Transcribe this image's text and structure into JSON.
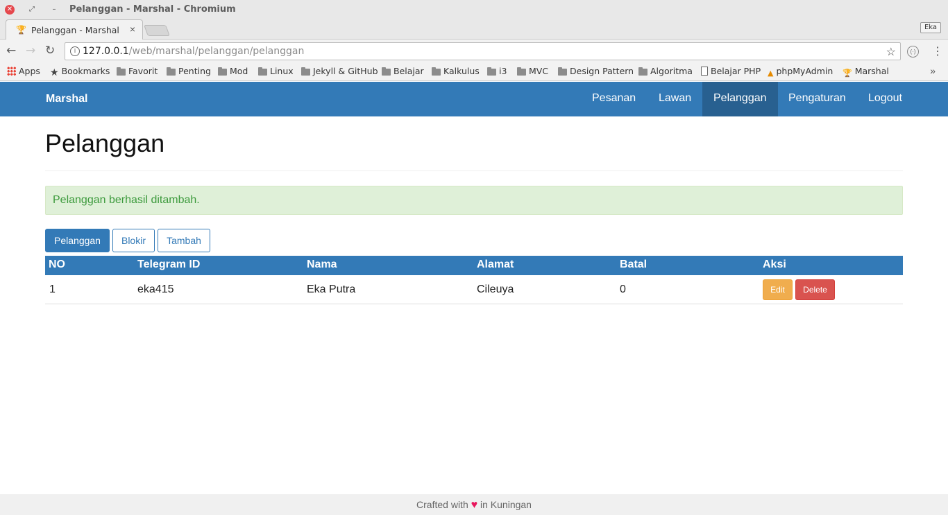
{
  "window": {
    "title": "Pelanggan - Marshal - Chromium",
    "close_glyph": "✕",
    "max_glyph": "⤢",
    "min_glyph": "–"
  },
  "tab": {
    "title": "Pelanggan - Marshal",
    "favicon": "trophy-icon",
    "close_glyph": "×"
  },
  "profile": {
    "label": "Eka"
  },
  "omnibox": {
    "url_host": "127.0.0.1",
    "url_path": "/web/marshal/pelanggan/pelanggan"
  },
  "bookmarks": [
    {
      "label": "Apps",
      "icon": "apps-grid-icon"
    },
    {
      "label": "Bookmarks",
      "icon": "star-icon"
    },
    {
      "label": "Favorit",
      "icon": "folder-icon"
    },
    {
      "label": "Penting",
      "icon": "folder-icon"
    },
    {
      "label": "Mod",
      "icon": "folder-icon"
    },
    {
      "label": "Linux",
      "icon": "folder-icon"
    },
    {
      "label": "Jekyll & GitHub",
      "icon": "folder-icon"
    },
    {
      "label": "Belajar",
      "icon": "folder-icon"
    },
    {
      "label": "Kalkulus",
      "icon": "folder-icon"
    },
    {
      "label": "i3",
      "icon": "folder-icon"
    },
    {
      "label": "MVC",
      "icon": "folder-icon"
    },
    {
      "label": "Design Pattern",
      "icon": "folder-icon"
    },
    {
      "label": "Algoritma",
      "icon": "folder-icon"
    },
    {
      "label": "Belajar PHP",
      "icon": "page-icon"
    },
    {
      "label": "phpMyAdmin",
      "icon": "phpmyadmin-icon"
    },
    {
      "label": "Marshal",
      "icon": "trophy-icon"
    }
  ],
  "navbar": {
    "brand": "Marshal",
    "items": [
      {
        "label": "Pesanan"
      },
      {
        "label": "Lawan"
      },
      {
        "label": "Pelanggan",
        "active": true
      },
      {
        "label": "Pengaturan"
      },
      {
        "label": "Logout"
      }
    ]
  },
  "page": {
    "title": "Pelanggan",
    "alert": "Pelanggan berhasil ditambah."
  },
  "filter_buttons": [
    {
      "label": "Pelanggan",
      "active": true
    },
    {
      "label": "Blokir"
    },
    {
      "label": "Tambah"
    }
  ],
  "table": {
    "headers": [
      "NO",
      "Telegram ID",
      "Nama",
      "Alamat",
      "Batal",
      "Aksi"
    ],
    "rows": [
      {
        "no": "1",
        "telegram_id": "eka415",
        "nama": "Eka Putra",
        "alamat": "Cileuya",
        "batal": "0"
      }
    ],
    "edit_label": "Edit",
    "delete_label": "Delete"
  },
  "footer": {
    "text_before": "Crafted with",
    "heart": "♥",
    "text_after": "in Kuningan"
  },
  "colors": {
    "primary": "#337ab7",
    "active_nav": "#286090",
    "alert_bg": "#dff0d8",
    "edit": "#f0ad4e",
    "delete": "#d9534f"
  }
}
